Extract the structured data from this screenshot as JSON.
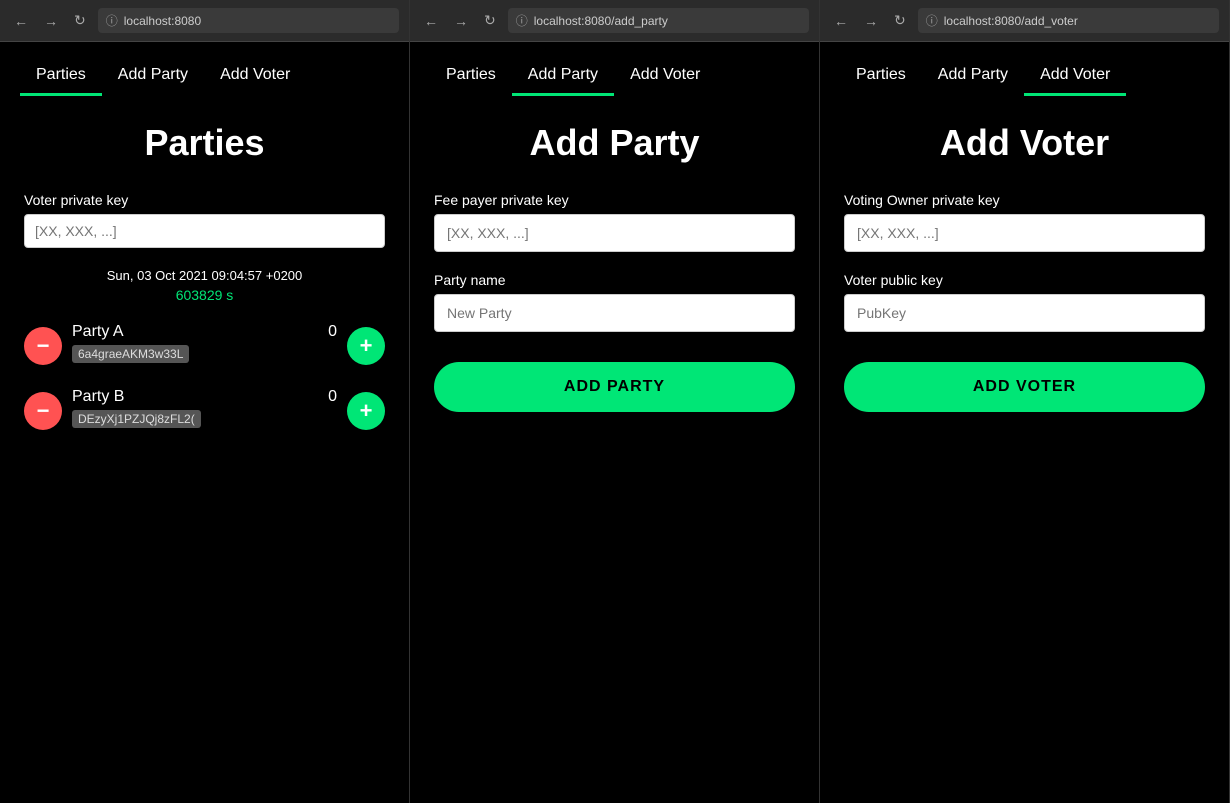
{
  "panels": [
    {
      "id": "panel-parties",
      "url": "localhost:8080",
      "nav": {
        "items": [
          {
            "label": "Parties",
            "active": true
          },
          {
            "label": "Add Party",
            "active": false
          },
          {
            "label": "Add Voter",
            "active": false
          }
        ]
      },
      "page": {
        "type": "parties",
        "title": "Parties",
        "voterPrivateKeyLabel": "Voter private key",
        "voterPrivateKeyPlaceholder": "[XX, XXX, ...]",
        "datetime": "Sun, 03 Oct 2021 09:04:57 +0200",
        "seconds": "603829 s",
        "parties": [
          {
            "name": "Party A",
            "count": "0",
            "key": "6a4graeAKM3w33L"
          },
          {
            "name": "Party B",
            "count": "0",
            "key": "DEzyXj1PZJQj8zFL2("
          }
        ]
      }
    },
    {
      "id": "panel-add-party",
      "url": "localhost:8080/add_party",
      "nav": {
        "items": [
          {
            "label": "Parties",
            "active": false
          },
          {
            "label": "Add Party",
            "active": true
          },
          {
            "label": "Add Voter",
            "active": false
          }
        ]
      },
      "page": {
        "type": "add-party",
        "title": "Add Party",
        "feePayerLabel": "Fee payer private key",
        "feePayerPlaceholder": "[XX, XXX, ...]",
        "partyNameLabel": "Party name",
        "partyNamePlaceholder": "New Party",
        "submitLabel": "ADD PARTY"
      }
    },
    {
      "id": "panel-add-voter",
      "url": "localhost:8080/add_voter",
      "nav": {
        "items": [
          {
            "label": "Parties",
            "active": false
          },
          {
            "label": "Add Party",
            "active": false
          },
          {
            "label": "Add Voter",
            "active": true
          }
        ]
      },
      "page": {
        "type": "add-voter",
        "title": "Add Voter",
        "ownerPrivateKeyLabel": "Voting Owner private key",
        "ownerPrivateKeyPlaceholder": "[XX, XXX, ...]",
        "voterPublicKeyLabel": "Voter public key",
        "voterPublicKeyPlaceholder": "PubKey",
        "submitLabel": "ADD VOTER"
      }
    }
  ],
  "colors": {
    "green": "#00e676",
    "red": "#ff5252",
    "bg": "#000000"
  }
}
